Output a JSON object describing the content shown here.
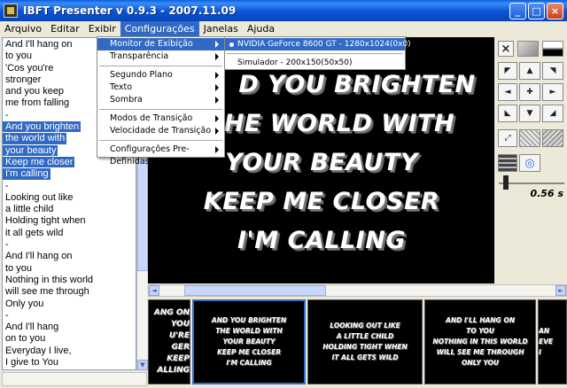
{
  "window": {
    "title": "IBFT Presenter v 0.9.3 - 2007.11.09"
  },
  "menubar": [
    "Arquivo",
    "Editar",
    "Exibir",
    "Configurações",
    "Janelas",
    "Ajuda"
  ],
  "config_menu": {
    "items": [
      "Monitor de Exibição",
      "Transparência",
      "Segundo Plano",
      "Texto",
      "Sombra",
      "Modos de Transição",
      "Velocidade de Transição",
      "Configurações Pre-Definidas"
    ]
  },
  "monitor_submenu": {
    "items": [
      "NVIDIA GeForce 8600 GT - 1280x1024(0x0)",
      "Simulador - 200x150(50x50)"
    ]
  },
  "lyrics": [
    "And I'll hang on",
    "to you",
    "'Cos you're",
    "stronger",
    "and you keep",
    "me from falling",
    "-",
    "And you brighten",
    "the world with",
    "your beauty",
    "Keep me closer",
    "I'm calling",
    "-",
    "Looking out like",
    "a little child",
    "Holding tight when",
    "it all gets wild",
    "-",
    "And I'll hang on",
    "to you",
    "Nothing in this world",
    "will see me through",
    "Only you",
    "-",
    "And I'll hang",
    "on to you",
    "Everyday I live,",
    "I give to You",
    "-"
  ],
  "preview": {
    "lines": [
      "D YOU BRIGHTEN",
      "HE WORLD WITH",
      "YOUR BEAUTY",
      "KEEP ME CLOSER",
      "I'M CALLING"
    ]
  },
  "tools": {
    "close_glyph": "×",
    "time": "0.56 s",
    "transition_speed": 0.56
  },
  "thumbs": [
    {
      "lines": [
        "ANG ON",
        "YOU",
        "U'RE",
        "GER",
        "KEEP",
        "ALLING"
      ]
    },
    {
      "lines": [
        "AND YOU BRIGHTEN",
        "THE WORLD WITH",
        "YOUR BEAUTY",
        "KEEP ME CLOSER",
        "I'M CALLING"
      ]
    },
    {
      "lines": [
        "LOOKING OUT LIKE",
        "A LITTLE CHILD",
        "HOLDING TIGHT WHEN",
        "IT ALL GETS WILD"
      ]
    },
    {
      "lines": [
        "AND I'LL HANG ON",
        "TO YOU",
        "NOTHING IN THIS WORLD",
        "WILL SEE ME THROUGH",
        "ONLY YOU"
      ]
    },
    {
      "lines": [
        "AN",
        "EVE",
        "I"
      ]
    }
  ]
}
